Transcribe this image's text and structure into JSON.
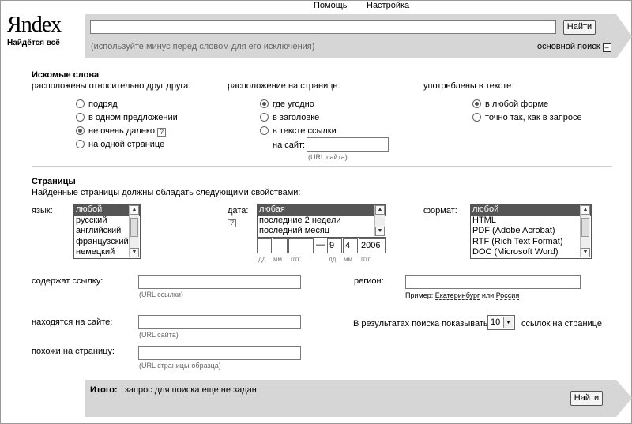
{
  "header": {
    "help": "Помощь",
    "settings": "Настройка"
  },
  "logo": {
    "first_letter": "Я",
    "rest": "ndex",
    "tagline": "Найдётся всё"
  },
  "search": {
    "query": "",
    "button": "Найти",
    "hint": "(используйте минус перед словом для его исключения)",
    "mode": "основной поиск",
    "collapse_icon": "minus-box-icon"
  },
  "words": {
    "title": "Искомые слова",
    "col1": {
      "label": "расположены относительно друг друга:",
      "options": [
        "подряд",
        "в одном предложении",
        "не очень далеко",
        "на одной странице"
      ],
      "selected": 2
    },
    "col2": {
      "label": "расположение на странице:",
      "options": [
        "где угодно",
        "в заголовке",
        "в тексте ссылки"
      ],
      "selected": 0,
      "site_label": "на сайт:",
      "site_hint": "(URL сайта)",
      "site_value": ""
    },
    "col3": {
      "label": "употреблены в тексте:",
      "options": [
        "в любой форме",
        "точно так, как в запросе"
      ],
      "selected": 0
    }
  },
  "pages": {
    "title": "Страницы",
    "subtitle": "Найденные страницы должны обладать следующими свойствами:",
    "lang": {
      "label": "язык:",
      "options": [
        "любой",
        "русский",
        "английский",
        "французский",
        "немецкий"
      ]
    },
    "date": {
      "label": "дата:",
      "options": [
        "любая",
        "последние 2 недели",
        "последний месяц"
      ],
      "dash": "—",
      "from": [
        "",
        "",
        ""
      ],
      "to": [
        "9",
        "4",
        "2006"
      ],
      "labels": [
        "дд",
        "мм",
        "гггг"
      ]
    },
    "format": {
      "label": "формат:",
      "options": [
        "любой",
        "HTML",
        "PDF (Adobe Acrobat)",
        "RTF (Rich Text Format)",
        "DOC (Microsoft Word)"
      ]
    },
    "link": {
      "label": "содержат ссылку:",
      "hint": "(URL ссылки)",
      "value": ""
    },
    "region": {
      "label": "регион:",
      "value": "",
      "example_label": "Пример:",
      "example1": "Екатеринбург",
      "or": "или",
      "example2": "Россия"
    },
    "site": {
      "label": "находятся на сайте:",
      "hint": "(URL сайта)",
      "value": ""
    },
    "results": {
      "label_before": "В результатах поиска показывать",
      "value": "10",
      "label_after": "ссылок на странице"
    },
    "similar": {
      "label": "похожи на страницу:",
      "hint": "(URL страницы-образца)",
      "value": ""
    }
  },
  "summary": {
    "label": "Итого:",
    "text": "запрос для поиска еще не задан",
    "button": "Найти"
  }
}
